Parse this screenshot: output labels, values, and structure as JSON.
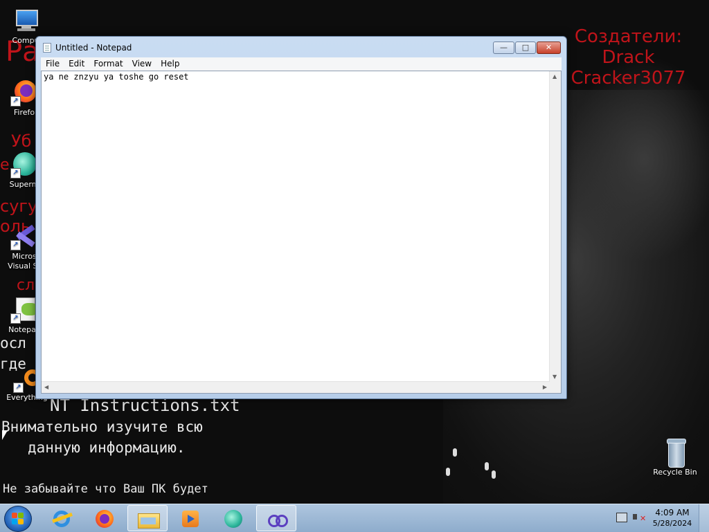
{
  "wallpaper": {
    "red_left_fragments": [
      "Ра",
      "Уб",
      "е",
      "сугу",
      "оль",
      "сл"
    ],
    "creators": [
      "Создатели:",
      "Drack",
      "Cracker3077"
    ],
    "instructions_title": "NT Instructions.txt",
    "instructions_lines": [
      "Внимательно изучите всю",
      "данную информацию."
    ],
    "instructions_note": "Не забывайте что Ваш ПК будет",
    "left_fragments": [
      "осл",
      "где"
    ]
  },
  "desktop_icons": [
    {
      "label": "Compu",
      "icon": "computer-icon"
    },
    {
      "label": "Firefo",
      "icon": "firefox-icon"
    },
    {
      "label": "Superm",
      "icon": "supermium-icon"
    },
    {
      "label": "Micros\nVisual St",
      "icon": "visual-studio-icon"
    },
    {
      "label": "Notepac",
      "icon": "notepad-plus-icon"
    },
    {
      "label": "Everything",
      "icon": "everything-icon"
    },
    {
      "label": "Recycle Bin",
      "icon": "recycle-bin-icon"
    }
  ],
  "notepad": {
    "title": "Untitled - Notepad",
    "menu": [
      "File",
      "Edit",
      "Format",
      "View",
      "Help"
    ],
    "content": "ya ne znzyu ya toshe go reset",
    "buttons": {
      "minimize": "—",
      "maximize": "□",
      "close": "✕"
    }
  },
  "taskbar": {
    "items": [
      "internet-explorer-icon",
      "firefox-icon",
      "explorer-icon",
      "media-player-icon",
      "supermium-icon",
      "visual-studio-icon"
    ],
    "time": "4:09 AM",
    "date": "5/28/2024"
  },
  "colors": {
    "accent_red": "#c0141a",
    "taskbar": "#9fbad8"
  }
}
